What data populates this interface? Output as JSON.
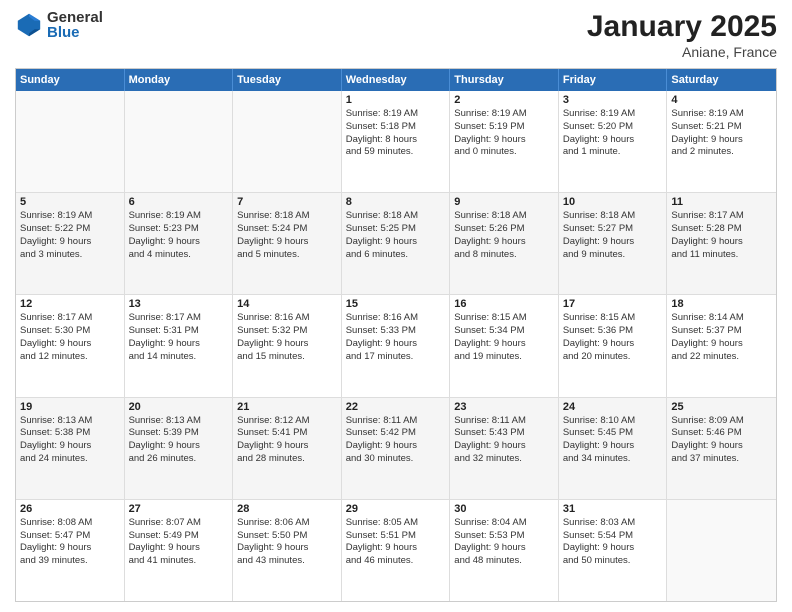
{
  "logo": {
    "general": "General",
    "blue": "Blue"
  },
  "title": "January 2025",
  "location": "Aniane, France",
  "header_days": [
    "Sunday",
    "Monday",
    "Tuesday",
    "Wednesday",
    "Thursday",
    "Friday",
    "Saturday"
  ],
  "weeks": [
    [
      {
        "day": "",
        "lines": [],
        "empty": true
      },
      {
        "day": "",
        "lines": [],
        "empty": true
      },
      {
        "day": "",
        "lines": [],
        "empty": true
      },
      {
        "day": "1",
        "lines": [
          "Sunrise: 8:19 AM",
          "Sunset: 5:18 PM",
          "Daylight: 8 hours",
          "and 59 minutes."
        ],
        "empty": false
      },
      {
        "day": "2",
        "lines": [
          "Sunrise: 8:19 AM",
          "Sunset: 5:19 PM",
          "Daylight: 9 hours",
          "and 0 minutes."
        ],
        "empty": false
      },
      {
        "day": "3",
        "lines": [
          "Sunrise: 8:19 AM",
          "Sunset: 5:20 PM",
          "Daylight: 9 hours",
          "and 1 minute."
        ],
        "empty": false
      },
      {
        "day": "4",
        "lines": [
          "Sunrise: 8:19 AM",
          "Sunset: 5:21 PM",
          "Daylight: 9 hours",
          "and 2 minutes."
        ],
        "empty": false
      }
    ],
    [
      {
        "day": "5",
        "lines": [
          "Sunrise: 8:19 AM",
          "Sunset: 5:22 PM",
          "Daylight: 9 hours",
          "and 3 minutes."
        ],
        "empty": false
      },
      {
        "day": "6",
        "lines": [
          "Sunrise: 8:19 AM",
          "Sunset: 5:23 PM",
          "Daylight: 9 hours",
          "and 4 minutes."
        ],
        "empty": false
      },
      {
        "day": "7",
        "lines": [
          "Sunrise: 8:18 AM",
          "Sunset: 5:24 PM",
          "Daylight: 9 hours",
          "and 5 minutes."
        ],
        "empty": false
      },
      {
        "day": "8",
        "lines": [
          "Sunrise: 8:18 AM",
          "Sunset: 5:25 PM",
          "Daylight: 9 hours",
          "and 6 minutes."
        ],
        "empty": false
      },
      {
        "day": "9",
        "lines": [
          "Sunrise: 8:18 AM",
          "Sunset: 5:26 PM",
          "Daylight: 9 hours",
          "and 8 minutes."
        ],
        "empty": false
      },
      {
        "day": "10",
        "lines": [
          "Sunrise: 8:18 AM",
          "Sunset: 5:27 PM",
          "Daylight: 9 hours",
          "and 9 minutes."
        ],
        "empty": false
      },
      {
        "day": "11",
        "lines": [
          "Sunrise: 8:17 AM",
          "Sunset: 5:28 PM",
          "Daylight: 9 hours",
          "and 11 minutes."
        ],
        "empty": false
      }
    ],
    [
      {
        "day": "12",
        "lines": [
          "Sunrise: 8:17 AM",
          "Sunset: 5:30 PM",
          "Daylight: 9 hours",
          "and 12 minutes."
        ],
        "empty": false
      },
      {
        "day": "13",
        "lines": [
          "Sunrise: 8:17 AM",
          "Sunset: 5:31 PM",
          "Daylight: 9 hours",
          "and 14 minutes."
        ],
        "empty": false
      },
      {
        "day": "14",
        "lines": [
          "Sunrise: 8:16 AM",
          "Sunset: 5:32 PM",
          "Daylight: 9 hours",
          "and 15 minutes."
        ],
        "empty": false
      },
      {
        "day": "15",
        "lines": [
          "Sunrise: 8:16 AM",
          "Sunset: 5:33 PM",
          "Daylight: 9 hours",
          "and 17 minutes."
        ],
        "empty": false
      },
      {
        "day": "16",
        "lines": [
          "Sunrise: 8:15 AM",
          "Sunset: 5:34 PM",
          "Daylight: 9 hours",
          "and 19 minutes."
        ],
        "empty": false
      },
      {
        "day": "17",
        "lines": [
          "Sunrise: 8:15 AM",
          "Sunset: 5:36 PM",
          "Daylight: 9 hours",
          "and 20 minutes."
        ],
        "empty": false
      },
      {
        "day": "18",
        "lines": [
          "Sunrise: 8:14 AM",
          "Sunset: 5:37 PM",
          "Daylight: 9 hours",
          "and 22 minutes."
        ],
        "empty": false
      }
    ],
    [
      {
        "day": "19",
        "lines": [
          "Sunrise: 8:13 AM",
          "Sunset: 5:38 PM",
          "Daylight: 9 hours",
          "and 24 minutes."
        ],
        "empty": false
      },
      {
        "day": "20",
        "lines": [
          "Sunrise: 8:13 AM",
          "Sunset: 5:39 PM",
          "Daylight: 9 hours",
          "and 26 minutes."
        ],
        "empty": false
      },
      {
        "day": "21",
        "lines": [
          "Sunrise: 8:12 AM",
          "Sunset: 5:41 PM",
          "Daylight: 9 hours",
          "and 28 minutes."
        ],
        "empty": false
      },
      {
        "day": "22",
        "lines": [
          "Sunrise: 8:11 AM",
          "Sunset: 5:42 PM",
          "Daylight: 9 hours",
          "and 30 minutes."
        ],
        "empty": false
      },
      {
        "day": "23",
        "lines": [
          "Sunrise: 8:11 AM",
          "Sunset: 5:43 PM",
          "Daylight: 9 hours",
          "and 32 minutes."
        ],
        "empty": false
      },
      {
        "day": "24",
        "lines": [
          "Sunrise: 8:10 AM",
          "Sunset: 5:45 PM",
          "Daylight: 9 hours",
          "and 34 minutes."
        ],
        "empty": false
      },
      {
        "day": "25",
        "lines": [
          "Sunrise: 8:09 AM",
          "Sunset: 5:46 PM",
          "Daylight: 9 hours",
          "and 37 minutes."
        ],
        "empty": false
      }
    ],
    [
      {
        "day": "26",
        "lines": [
          "Sunrise: 8:08 AM",
          "Sunset: 5:47 PM",
          "Daylight: 9 hours",
          "and 39 minutes."
        ],
        "empty": false
      },
      {
        "day": "27",
        "lines": [
          "Sunrise: 8:07 AM",
          "Sunset: 5:49 PM",
          "Daylight: 9 hours",
          "and 41 minutes."
        ],
        "empty": false
      },
      {
        "day": "28",
        "lines": [
          "Sunrise: 8:06 AM",
          "Sunset: 5:50 PM",
          "Daylight: 9 hours",
          "and 43 minutes."
        ],
        "empty": false
      },
      {
        "day": "29",
        "lines": [
          "Sunrise: 8:05 AM",
          "Sunset: 5:51 PM",
          "Daylight: 9 hours",
          "and 46 minutes."
        ],
        "empty": false
      },
      {
        "day": "30",
        "lines": [
          "Sunrise: 8:04 AM",
          "Sunset: 5:53 PM",
          "Daylight: 9 hours",
          "and 48 minutes."
        ],
        "empty": false
      },
      {
        "day": "31",
        "lines": [
          "Sunrise: 8:03 AM",
          "Sunset: 5:54 PM",
          "Daylight: 9 hours",
          "and 50 minutes."
        ],
        "empty": false
      },
      {
        "day": "",
        "lines": [],
        "empty": true
      }
    ]
  ]
}
